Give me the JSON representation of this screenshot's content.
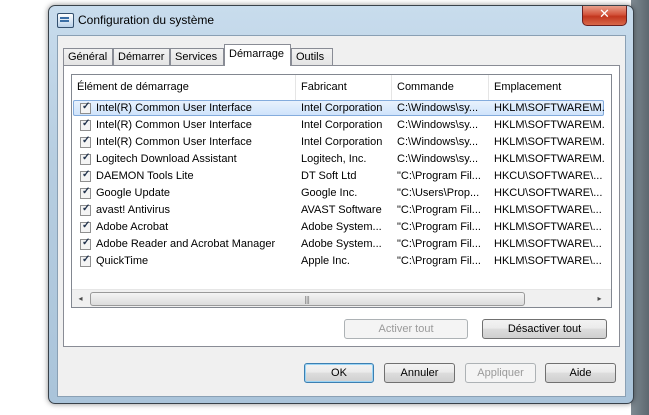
{
  "window": {
    "title": "Configuration du système",
    "close_label": "✕"
  },
  "tabs": [
    {
      "label": "Général"
    },
    {
      "label": "Démarrer"
    },
    {
      "label": "Services"
    },
    {
      "label": "Démarrage",
      "active": true
    },
    {
      "label": "Outils"
    }
  ],
  "table": {
    "columns": [
      "Élément de démarrage",
      "Fabricant",
      "Commande",
      "Emplacement"
    ],
    "rows": [
      {
        "name": "Intel(R) Common User Interface",
        "maker": "Intel Corporation",
        "cmd": "C:\\Windows\\sy...",
        "loc": "HKLM\\SOFTWARE\\M...",
        "checked": true,
        "selected": true
      },
      {
        "name": "Intel(R) Common User Interface",
        "maker": "Intel Corporation",
        "cmd": "C:\\Windows\\sy...",
        "loc": "HKLM\\SOFTWARE\\M...",
        "checked": true
      },
      {
        "name": "Intel(R) Common User Interface",
        "maker": "Intel Corporation",
        "cmd": "C:\\Windows\\sy...",
        "loc": "HKLM\\SOFTWARE\\M...",
        "checked": true
      },
      {
        "name": "Logitech Download Assistant",
        "maker": "Logitech, Inc.",
        "cmd": "C:\\Windows\\sy...",
        "loc": "HKLM\\SOFTWARE\\M...",
        "checked": true
      },
      {
        "name": "DAEMON Tools Lite",
        "maker": "DT Soft Ltd",
        "cmd": "\"C:\\Program Fil...",
        "loc": "HKCU\\SOFTWARE\\...",
        "checked": true
      },
      {
        "name": "Google Update",
        "maker": "Google Inc.",
        "cmd": "\"C:\\Users\\Prop...",
        "loc": "HKCU\\SOFTWARE\\...",
        "checked": true
      },
      {
        "name": "avast! Antivirus",
        "maker": "AVAST Software",
        "cmd": "\"C:\\Program Fil...",
        "loc": "HKLM\\SOFTWARE\\...",
        "checked": true
      },
      {
        "name": "Adobe Acrobat",
        "maker": "Adobe System...",
        "cmd": "\"C:\\Program Fil...",
        "loc": "HKLM\\SOFTWARE\\...",
        "checked": true
      },
      {
        "name": "Adobe Reader and Acrobat Manager",
        "maker": "Adobe System...",
        "cmd": "\"C:\\Program Fil...",
        "loc": "HKLM\\SOFTWARE\\...",
        "checked": true
      },
      {
        "name": "QuickTime",
        "maker": "Apple Inc.",
        "cmd": "\"C:\\Program Fil...",
        "loc": "HKLM\\SOFTWARE\\...",
        "checked": true
      }
    ]
  },
  "scrollbar": {
    "left_arrow": "◂",
    "right_arrow": "▸",
    "grip": "|||"
  },
  "buttons": {
    "enable_all": "Activer tout",
    "disable_all": "Désactiver tout",
    "ok": "OK",
    "cancel": "Annuler",
    "apply": "Appliquer",
    "help": "Aide"
  }
}
